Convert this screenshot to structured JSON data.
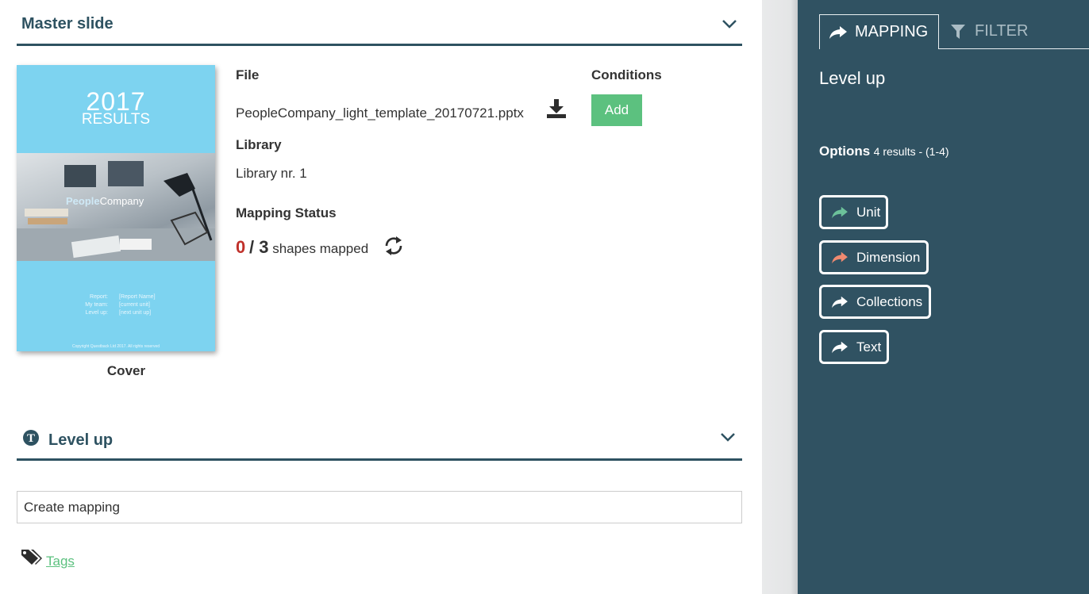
{
  "master_section": {
    "title": "Master slide"
  },
  "thumbnail": {
    "year": "2017",
    "results": "RESULTS",
    "brand_bold": "People",
    "brand_rest": "Company",
    "meta_labels": [
      "Report:",
      "My team:",
      "Level up:"
    ],
    "meta_values": [
      "[Report Name]",
      "[current unit]",
      "[next unit up]"
    ],
    "copyright": "Copyright Questback Ltd 2017. All rights reserved",
    "caption": "Cover"
  },
  "file": {
    "label": "File",
    "name": "PeopleCompany_light_template_20170721.pptx",
    "download_icon": "download-icon"
  },
  "conditions": {
    "label": "Conditions",
    "add_label": "Add"
  },
  "library": {
    "label": "Library",
    "value": "Library nr. 1"
  },
  "mapping_status": {
    "label": "Mapping Status",
    "mapped": "0",
    "separator": "/ 3",
    "suffix": "shapes mapped",
    "refresh_icon": "refresh-icon"
  },
  "levelup_section": {
    "title": "Level up",
    "icon_letter": "T"
  },
  "create_mapping": {
    "value": "Create mapping"
  },
  "tags": {
    "label": "Tags",
    "icon": "tags-icon"
  },
  "panel": {
    "tabs": [
      {
        "label": "MAPPING",
        "icon": "share-arrow-icon",
        "active": true
      },
      {
        "label": "FILTER",
        "icon": "filter-icon",
        "active": false
      }
    ],
    "title": "Level up",
    "options_label": "Options",
    "options_count": "4 results - (1-4)",
    "options": [
      {
        "label": "Unit",
        "arrow_color": "#6cc19a"
      },
      {
        "label": "Dimension",
        "arrow_color": "#f08a70"
      },
      {
        "label": "Collections",
        "arrow_color": "#ffffff"
      },
      {
        "label": "Text",
        "arrow_color": "#ffffff"
      }
    ]
  },
  "colors": {
    "accent_dark": "#2e5261",
    "panel_bg": "#305262",
    "add_green": "#5cc17f",
    "status_red": "#c0312b"
  }
}
